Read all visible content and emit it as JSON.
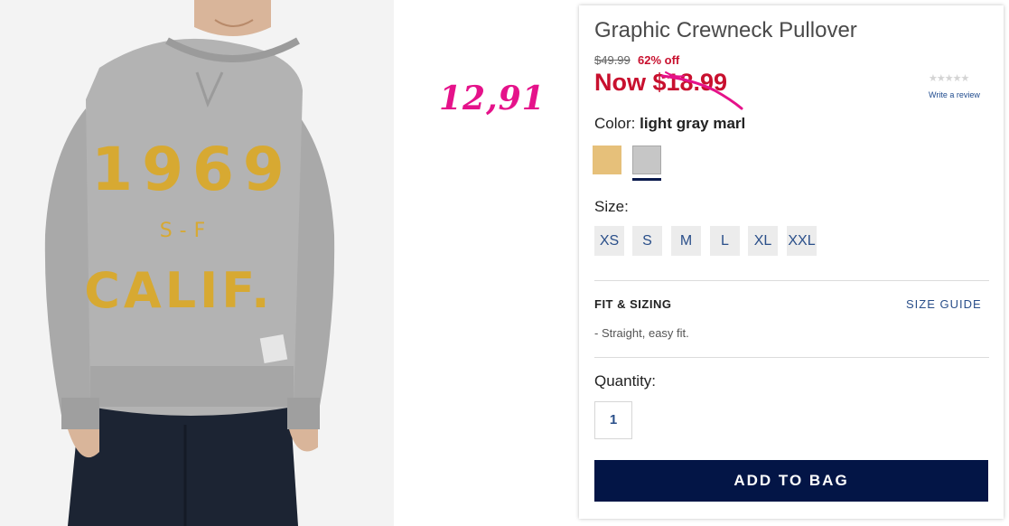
{
  "product": {
    "title": "Graphic Crewneck Pullover",
    "original_price": "$49.99",
    "discount": "62% off",
    "now_price": "Now $18.99",
    "write_review": "Write a review",
    "stars": "★★★★★",
    "rating_stars": 0,
    "image_graphic": {
      "line1": "1969",
      "line2": "S-F",
      "line3": "CALIF."
    }
  },
  "annotation": {
    "handwritten_price": "12,91",
    "color": "#e5128a"
  },
  "color": {
    "label": "Color:",
    "selected_value": "light gray marl",
    "swatches": [
      {
        "name": "tan",
        "hex": "#e6c07a"
      },
      {
        "name": "light gray marl",
        "hex": "#c6c6c6",
        "selected": true
      }
    ]
  },
  "size": {
    "label": "Size:",
    "options": [
      "XS",
      "S",
      "M",
      "L",
      "XL",
      "XXL"
    ]
  },
  "fit": {
    "title": "FIT & SIZING",
    "size_guide": "SIZE GUIDE",
    "note": "-  Straight, easy fit."
  },
  "quantity": {
    "label": "Quantity:",
    "value": "1"
  },
  "cta": {
    "add_to_bag": "ADD TO BAG"
  },
  "colors": {
    "sale_red": "#c8102e",
    "link_blue": "#2a4f8a",
    "cta_navy": "#031546"
  }
}
